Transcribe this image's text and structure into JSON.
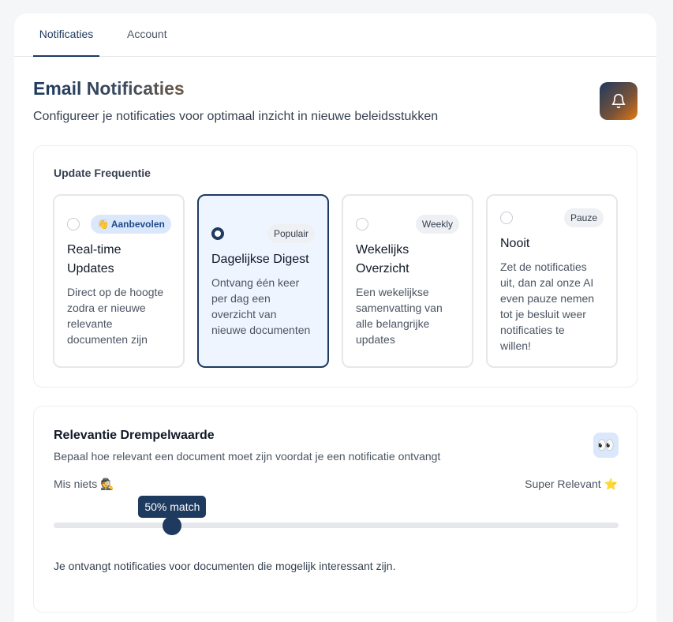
{
  "tabs": [
    {
      "label": "Notificaties",
      "active": true
    },
    {
      "label": "Account",
      "active": false
    }
  ],
  "header": {
    "title": "Email Notificaties",
    "subtitle": "Configureer je notificaties voor optimaal inzicht in nieuwe beleidsstukken",
    "icon": "bell-icon"
  },
  "frequency": {
    "label": "Update Frequentie",
    "selected_index": 1,
    "options": [
      {
        "title_lines": [
          "Real-time",
          "Updates"
        ],
        "badge": "👋 Aanbevolen",
        "badge_style": "blue",
        "desc_lines": [
          "Direct op de hoogte",
          "zodra er nieuwe",
          "relevante",
          "documenten zijn"
        ]
      },
      {
        "title_lines": [
          "Dagelijkse Digest"
        ],
        "badge": "Populair",
        "badge_style": "gray",
        "desc_lines": [
          "Ontvang één keer",
          "per dag een",
          "overzicht van",
          "nieuwe documenten"
        ]
      },
      {
        "title_lines": [
          "Wekelijks",
          "Overzicht"
        ],
        "badge": "Weekly",
        "badge_style": "gray",
        "desc_lines": [
          "Een wekelijkse",
          "samenvatting van",
          "alle belangrijke",
          "updates"
        ]
      },
      {
        "title_lines": [
          "Nooit"
        ],
        "badge": "Pauze",
        "badge_style": "gray",
        "desc_lines": [
          "Zet de notificaties",
          "uit, dan zal onze AI",
          "even pauze nemen",
          "tot je besluit weer",
          "notificaties te",
          "willen!"
        ]
      }
    ]
  },
  "relevance": {
    "title": "Relevantie Drempelwaarde",
    "subtitle": "Bepaal hoe relevant een document moet zijn voordat je een notificatie ontvangt",
    "icon_emoji": "👀",
    "min_label": "Mis niets 🕵️",
    "max_label": "Super Relevant ⭐",
    "value_fraction": 0.21,
    "tooltip": "50% match",
    "note": "Je ontvangt notificaties voor documenten die mogelijk interessant zijn."
  },
  "colors": {
    "accent": "#1e3a5f",
    "selected_bg": "#eef5ff",
    "badge_blue_bg": "#dbe8fb"
  }
}
